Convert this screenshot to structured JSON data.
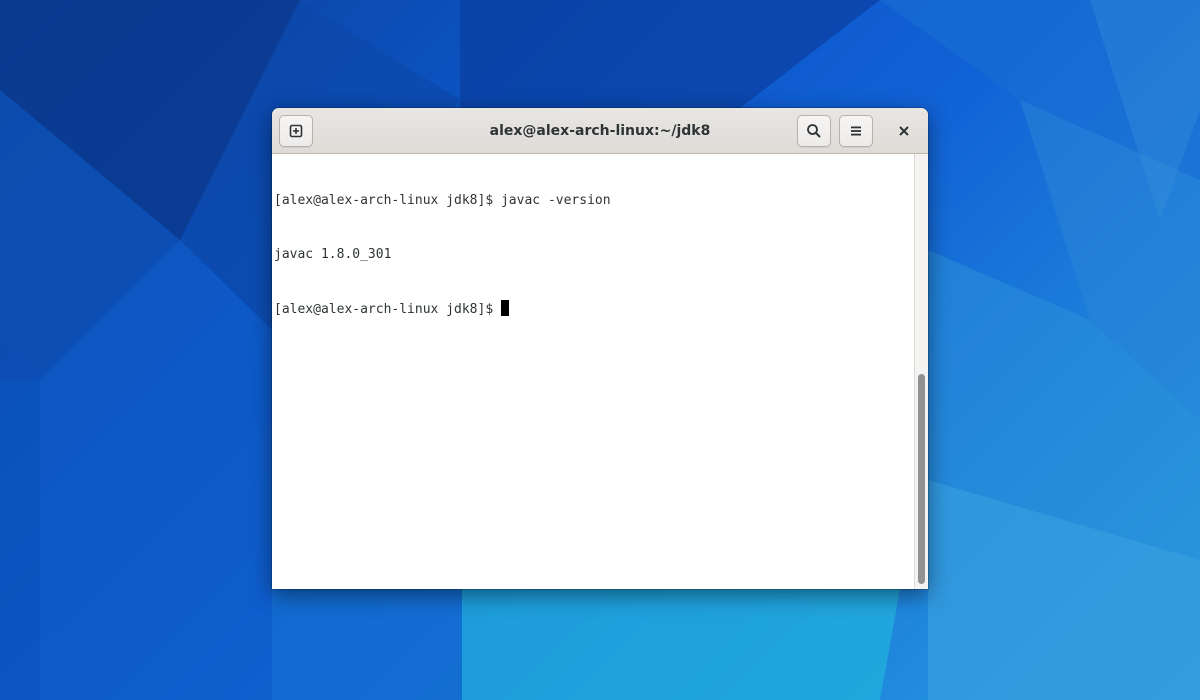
{
  "window": {
    "title": "alex@alex-arch-linux:~/jdk8"
  },
  "header_buttons": {
    "new_tab_icon": "new-tab-icon",
    "search_icon": "search-icon",
    "menu_icon": "hamburger-menu-icon",
    "close_icon": "close-icon"
  },
  "terminal": {
    "lines": [
      {
        "prompt": "[alex@alex-arch-linux jdk8]$ ",
        "command": "javac -version"
      },
      {
        "output": "javac 1.8.0_301"
      },
      {
        "prompt": "[alex@alex-arch-linux jdk8]$ ",
        "command": ""
      }
    ]
  },
  "colors": {
    "terminal_background": "#ffffff",
    "terminal_text": "#2e3436",
    "headerbar": "#e3e1de",
    "wallpaper_primary": "#0d56c8",
    "wallpaper_accent": "#2aa2e2"
  }
}
